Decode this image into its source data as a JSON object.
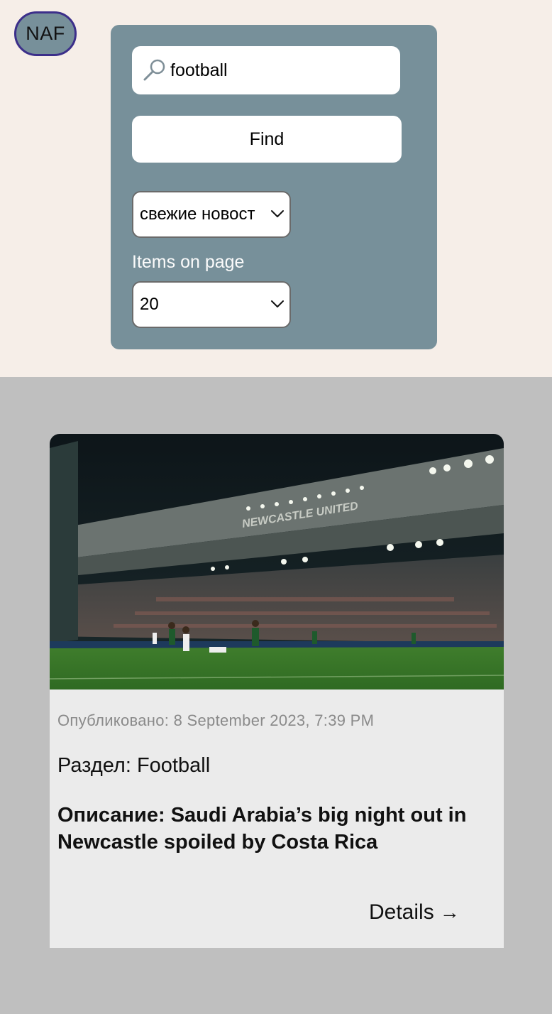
{
  "logo": {
    "text": "NAF"
  },
  "search": {
    "value": "football",
    "placeholder": "",
    "icon": "search-icon"
  },
  "find_button": {
    "label": "Find"
  },
  "sort_select": {
    "selected": "свежие новост"
  },
  "items_per_page": {
    "label": "Items on page",
    "selected": "20"
  },
  "article": {
    "published": "Опубликовано: 8 September 2023, 7:39 PM",
    "section": "Раздел: Football",
    "description": "Описание: Saudi Arabia’s big night out in Newcastle spoiled by Costa Rica",
    "details_label": "Details",
    "details_arrow": "→",
    "image_sign": "NEWCASTLE UNITED"
  },
  "colors": {
    "top_bg": "#f6eee8",
    "panel_bg": "#77909a",
    "bottom_bg": "#bfbfbf",
    "card_bg": "#ebebeb",
    "logo_border": "#3c2f8a"
  }
}
